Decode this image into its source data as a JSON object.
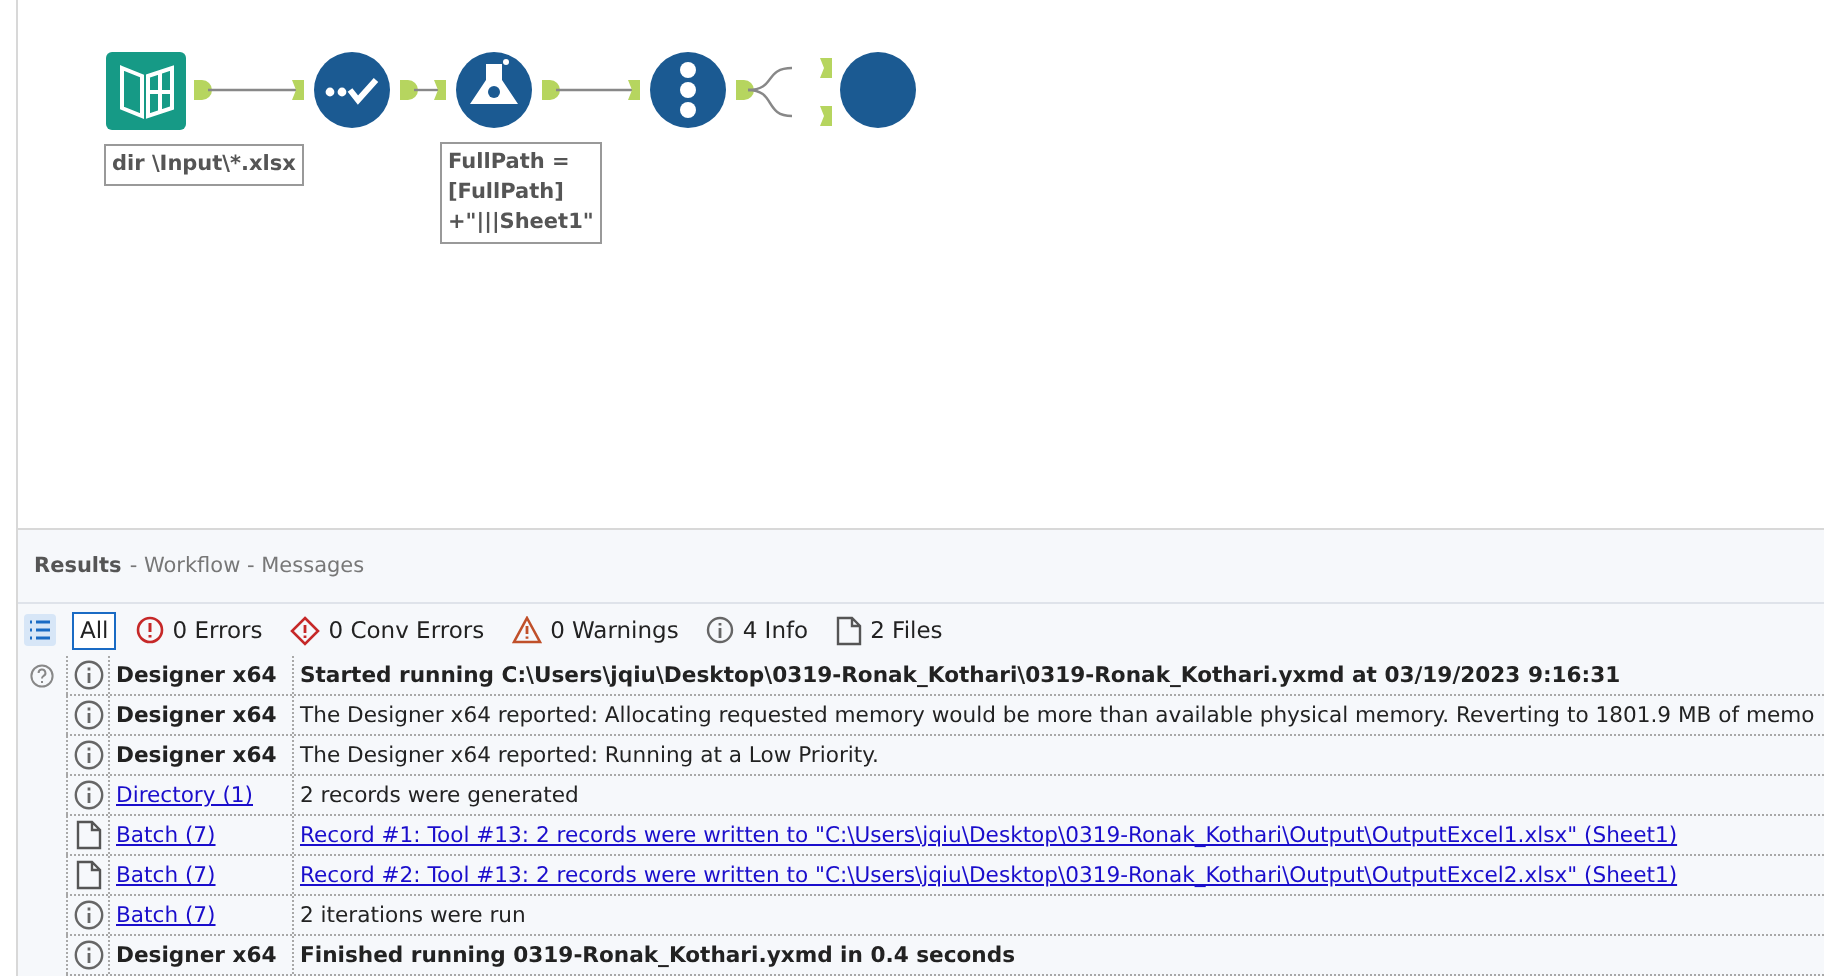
{
  "canvas": {
    "tools": [
      {
        "kind": "input",
        "annotation": [
          "dir \\Input\\*.xlsx"
        ]
      },
      {
        "kind": "select"
      },
      {
        "kind": "formula",
        "annotation": [
          "FullPath =",
          "[FullPath]",
          "+\"|||Sheet1\""
        ]
      },
      {
        "kind": "recordid"
      },
      {
        "kind": "output"
      }
    ]
  },
  "results": {
    "title": "Results",
    "breadcrumb": "- Workflow - Messages",
    "filters": [
      {
        "kind": "all",
        "label": "All",
        "selected": true
      },
      {
        "kind": "error",
        "label": "0 Errors",
        "selected": false
      },
      {
        "kind": "conv",
        "label": "0 Conv Errors",
        "selected": false
      },
      {
        "kind": "warning",
        "label": "0 Warnings",
        "selected": false
      },
      {
        "kind": "info",
        "label": "4 Info",
        "selected": false
      },
      {
        "kind": "file",
        "label": "2 Files",
        "selected": false
      }
    ],
    "rows": [
      {
        "kind": "info",
        "source": "Designer x64",
        "source_link": false,
        "message": "Started running C:\\Users\\jqiu\\Desktop\\0319-Ronak_Kothari\\0319-Ronak_Kothari.yxmd at 03/19/2023 9:16:31",
        "bold": true,
        "link": false
      },
      {
        "kind": "info",
        "source": "Designer x64",
        "source_link": false,
        "message": "The Designer x64 reported: Allocating requested memory would be more than available physical memory. Reverting to 1801.9 MB of memo",
        "bold": false,
        "link": false
      },
      {
        "kind": "info",
        "source": "Designer x64",
        "source_link": false,
        "message": "The Designer x64 reported: Running at a Low Priority.",
        "bold": false,
        "link": false
      },
      {
        "kind": "info",
        "source": "Directory (1)",
        "source_link": true,
        "message": "2 records were generated",
        "bold": false,
        "link": false
      },
      {
        "kind": "file",
        "source": "Batch (7)",
        "source_link": true,
        "message": "Record #1: Tool #13: 2 records were written to \"C:\\Users\\jqiu\\Desktop\\0319-Ronak_Kothari\\Output\\OutputExcel1.xlsx\" (Sheet1)",
        "bold": false,
        "link": true
      },
      {
        "kind": "file",
        "source": "Batch (7)",
        "source_link": true,
        "message": "Record #2: Tool #13: 2 records were written to \"C:\\Users\\jqiu\\Desktop\\0319-Ronak_Kothari\\Output\\OutputExcel2.xlsx\" (Sheet1)",
        "bold": false,
        "link": true
      },
      {
        "kind": "info",
        "source": "Batch (7)",
        "source_link": true,
        "message": "2 iterations were run",
        "bold": false,
        "link": false
      },
      {
        "kind": "info",
        "source": "Designer x64",
        "source_link": false,
        "message": "Finished running 0319-Ronak_Kothari.yxmd in 0.4 seconds",
        "bold": true,
        "link": false
      }
    ]
  }
}
